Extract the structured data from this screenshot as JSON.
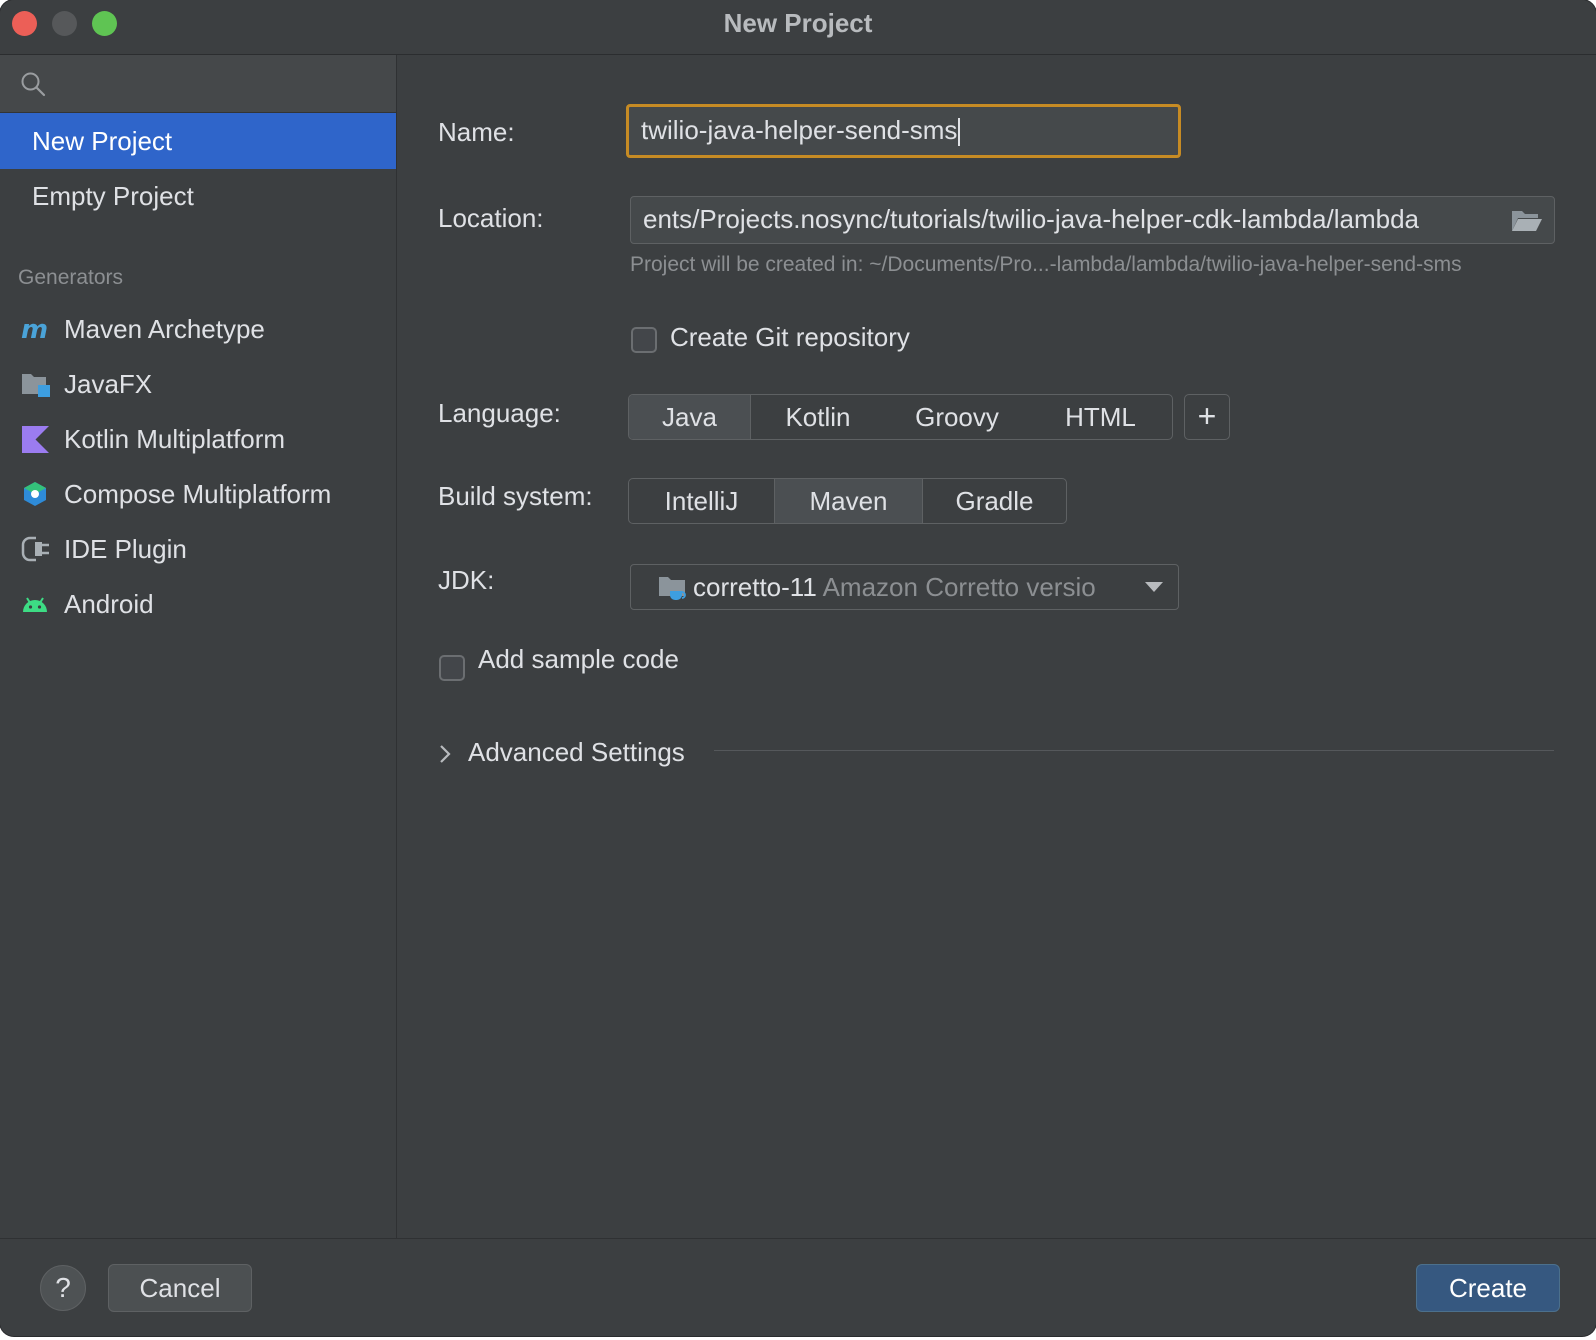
{
  "window": {
    "title": "New Project"
  },
  "sidebar": {
    "search_placeholder": "",
    "items": [
      {
        "label": "New Project",
        "selected": true
      },
      {
        "label": "Empty Project",
        "selected": false
      }
    ],
    "generators_label": "Generators",
    "generators": [
      {
        "label": "Maven Archetype",
        "icon": "maven-icon"
      },
      {
        "label": "JavaFX",
        "icon": "javafx-icon"
      },
      {
        "label": "Kotlin Multiplatform",
        "icon": "kotlin-icon"
      },
      {
        "label": "Compose Multiplatform",
        "icon": "compose-icon"
      },
      {
        "label": "IDE Plugin",
        "icon": "plugin-icon"
      },
      {
        "label": "Android",
        "icon": "android-icon"
      }
    ]
  },
  "form": {
    "name_label": "Name:",
    "name_value": "twilio-java-helper-send-sms",
    "location_label": "Location:",
    "location_value": "ents/Projects.nosync/tutorials/twilio-java-helper-cdk-lambda/lambda",
    "location_hint": "Project will be created in: ~/Documents/Pro...-lambda/lambda/twilio-java-helper-send-sms",
    "git_label": "Create Git repository",
    "git_checked": false,
    "language_label": "Language:",
    "languages": [
      "Java",
      "Kotlin",
      "Groovy",
      "HTML"
    ],
    "language_selected": "Java",
    "add_language": "+",
    "build_label": "Build system:",
    "build_systems": [
      "IntelliJ",
      "Maven",
      "Gradle"
    ],
    "build_selected": "Maven",
    "jdk_label": "JDK:",
    "jdk_name": "corretto-11",
    "jdk_detail": "Amazon Corretto versio",
    "sample_label": "Add sample code",
    "sample_checked": false,
    "advanced_label": "Advanced Settings"
  },
  "footer": {
    "help_label": "?",
    "cancel_label": "Cancel",
    "create_label": "Create"
  },
  "colors": {
    "background": "#3c3f41",
    "selection": "#2f65ca",
    "focus_border": "#c68b24",
    "primary_button": "#365880"
  }
}
